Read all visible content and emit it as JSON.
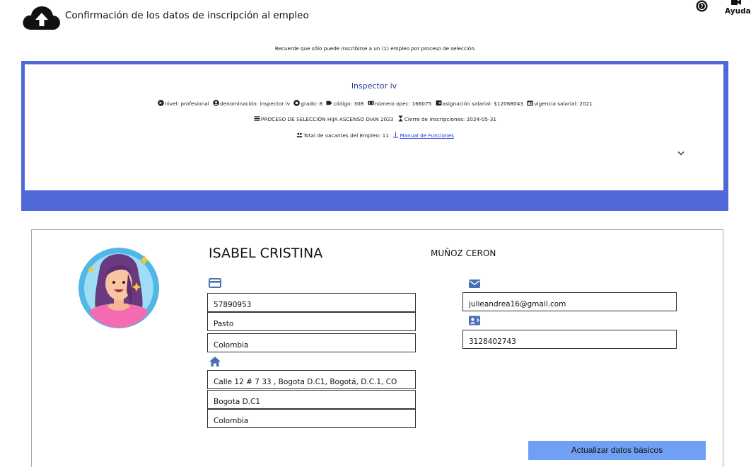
{
  "header": {
    "title": "Confirmación de los datos de inscripción al empleo",
    "help_label": "Ayudas"
  },
  "notice": "Recuerde que sólo puede inscribirse a un (1) empleo por proceso de selección.",
  "job": {
    "title": "Inspector iv",
    "nivel": "nivel: profesional",
    "denominacion": "denominación: inspector iv",
    "grado": "grado: 8",
    "codigo": "código: 308",
    "numero_opec": "número opec: 166075",
    "asignacion": "asignación salarial: $12068043",
    "vigencia": "vigencia salarial: 2021",
    "proceso": "PROCESO DE SELECCIÓN HIJA ASCENSO DIAN 2023",
    "cierre": "Cierre de inscripciones: 2024-05-31",
    "vacantes": "Total de vacantes del Empleo: 11",
    "manual_link": "Manual de Funciones"
  },
  "profile": {
    "first_name": "ISABEL CRISTINA",
    "last_name": "MUÑOZ CERON",
    "document": "57890953",
    "document_city": "Pasto",
    "document_country": "Colombia",
    "address": "Calle 12 # 7 33 , Bogota D.C1, Bogotá, D.C.1, CO",
    "address_city": "Bogota D.C1",
    "address_country": "Colombia",
    "email": "julieandrea16@gmail.com",
    "phone": "3128402743"
  },
  "actions": {
    "update_label": "Actualizar datos básicos"
  },
  "colors": {
    "panel_blue": "#5069d9",
    "button_blue": "#6fa0f4",
    "icon_blue": "#4a6fb5",
    "link_blue": "#1a3bd6"
  },
  "icons": [
    "cloud-upload-icon",
    "help-circle-icon",
    "video-icon",
    "chevron-down-icon",
    "credit-card-icon",
    "home-icon",
    "mail-icon",
    "contact-card-icon"
  ]
}
